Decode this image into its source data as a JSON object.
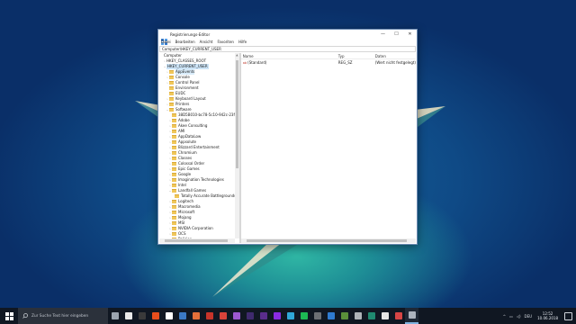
{
  "window": {
    "title": "Registrierungs-Editor",
    "controls": {
      "minimize": "—",
      "maximize": "☐",
      "close": "✕"
    },
    "menu": [
      "Datei",
      "Bearbeiten",
      "Ansicht",
      "Favoriten",
      "Hilfe"
    ],
    "address": "Computer\\HKEY_CURRENT_USER"
  },
  "tree": {
    "items": [
      {
        "label": "Computer",
        "level": 0,
        "chev": "",
        "folder": false
      },
      {
        "label": "HKEY_CLASSES_ROOT",
        "level": 1,
        "chev": "›",
        "folder": false
      },
      {
        "label": "HKEY_CURRENT_USER",
        "level": 1,
        "chev": "⌄",
        "folder": false,
        "selected": true
      },
      {
        "label": "AppEvents",
        "level": 2,
        "chev": "›",
        "folder": true,
        "highlight": true
      },
      {
        "label": "Console",
        "level": 2,
        "chev": "›",
        "folder": true
      },
      {
        "label": "Control Panel",
        "level": 2,
        "chev": "›",
        "folder": true
      },
      {
        "label": "Environment",
        "level": 2,
        "chev": "",
        "folder": true
      },
      {
        "label": "EUDC",
        "level": 2,
        "chev": "",
        "folder": true
      },
      {
        "label": "Keyboard Layout",
        "level": 2,
        "chev": "›",
        "folder": true
      },
      {
        "label": "Printers",
        "level": 2,
        "chev": "›",
        "folder": true
      },
      {
        "label": "Software",
        "level": 2,
        "chev": "⌄",
        "folder": true
      },
      {
        "label": "38D5B010-bc78-5c10-942c-23f2ebb5ec5",
        "level": 3,
        "chev": "",
        "folder": true
      },
      {
        "label": "Adobe",
        "level": 3,
        "chev": "›",
        "folder": true
      },
      {
        "label": "Akee Consulting",
        "level": 3,
        "chev": "›",
        "folder": true
      },
      {
        "label": "AMI",
        "level": 3,
        "chev": "›",
        "folder": true
      },
      {
        "label": "AppDataLow",
        "level": 3,
        "chev": "›",
        "folder": true
      },
      {
        "label": "Appsolute",
        "level": 3,
        "chev": "›",
        "folder": true
      },
      {
        "label": "Blizzard Entertainment",
        "level": 3,
        "chev": "›",
        "folder": true
      },
      {
        "label": "Chromium",
        "level": 3,
        "chev": "›",
        "folder": true
      },
      {
        "label": "Classes",
        "level": 3,
        "chev": "›",
        "folder": true
      },
      {
        "label": "Colossal Order",
        "level": 3,
        "chev": "›",
        "folder": true
      },
      {
        "label": "Epic Games",
        "level": 3,
        "chev": "›",
        "folder": true
      },
      {
        "label": "Google",
        "level": 3,
        "chev": "›",
        "folder": true
      },
      {
        "label": "Imagination Technologies",
        "level": 3,
        "chev": "›",
        "folder": true
      },
      {
        "label": "Intel",
        "level": 3,
        "chev": "›",
        "folder": true
      },
      {
        "label": "Landfall Games",
        "level": 3,
        "chev": "⌄",
        "folder": true
      },
      {
        "label": "Totally Accurate Battlegrounds",
        "level": 4,
        "chev": "",
        "folder": true
      },
      {
        "label": "Logitech",
        "level": 3,
        "chev": "›",
        "folder": true
      },
      {
        "label": "Macromedia",
        "level": 3,
        "chev": "›",
        "folder": true
      },
      {
        "label": "Microsoft",
        "level": 3,
        "chev": "›",
        "folder": true
      },
      {
        "label": "Mojang",
        "level": 3,
        "chev": "›",
        "folder": true
      },
      {
        "label": "MSI",
        "level": 3,
        "chev": "›",
        "folder": true
      },
      {
        "label": "NVIDIA Corporation",
        "level": 3,
        "chev": "›",
        "folder": true
      },
      {
        "label": "OCS",
        "level": 3,
        "chev": "›",
        "folder": true
      },
      {
        "label": "Policies",
        "level": 3,
        "chev": "›",
        "folder": true
      }
    ]
  },
  "values": {
    "headers": {
      "name": "Name",
      "type": "Typ",
      "data": "Daten"
    },
    "rows": [
      {
        "name": "(Standard)",
        "type": "REG_SZ",
        "data": "(Wert nicht festgelegt)"
      }
    ]
  },
  "taskbar": {
    "search_placeholder": "Zur Suche Text hier eingeben",
    "apps": [
      {
        "name": "task-view",
        "color": "#9aa4b0"
      },
      {
        "name": "app-1",
        "color": "#e9e9e9"
      },
      {
        "name": "app-2",
        "color": "#3a3a3a"
      },
      {
        "name": "app-3",
        "color": "#e84e1c"
      },
      {
        "name": "app-4",
        "color": "#ffffff"
      },
      {
        "name": "app-5",
        "color": "#3b79c4"
      },
      {
        "name": "app-6",
        "color": "#e3703a"
      },
      {
        "name": "app-7",
        "color": "#c8342a"
      },
      {
        "name": "app-8",
        "color": "#d9433a"
      },
      {
        "name": "app-9",
        "color": "#9b59d0"
      },
      {
        "name": "app-10",
        "color": "#3f2a6e"
      },
      {
        "name": "app-11",
        "color": "#5a2d8c"
      },
      {
        "name": "app-12",
        "color": "#8a2be2"
      },
      {
        "name": "app-13",
        "color": "#30a8d8"
      },
      {
        "name": "app-14",
        "color": "#1db954"
      },
      {
        "name": "app-15",
        "color": "#6c6f74"
      },
      {
        "name": "app-16",
        "color": "#2f7bd1"
      },
      {
        "name": "app-17",
        "color": "#5a8f3a"
      },
      {
        "name": "app-18",
        "color": "#aeb3b8"
      },
      {
        "name": "app-19",
        "color": "#1f8a70"
      },
      {
        "name": "app-20",
        "color": "#e6e6e6"
      },
      {
        "name": "app-21",
        "color": "#d64545"
      },
      {
        "name": "app-22",
        "color": "#aab2bd"
      }
    ],
    "tray": {
      "lang": "DEU",
      "time": "12:52",
      "date": "10.06.2018"
    }
  }
}
